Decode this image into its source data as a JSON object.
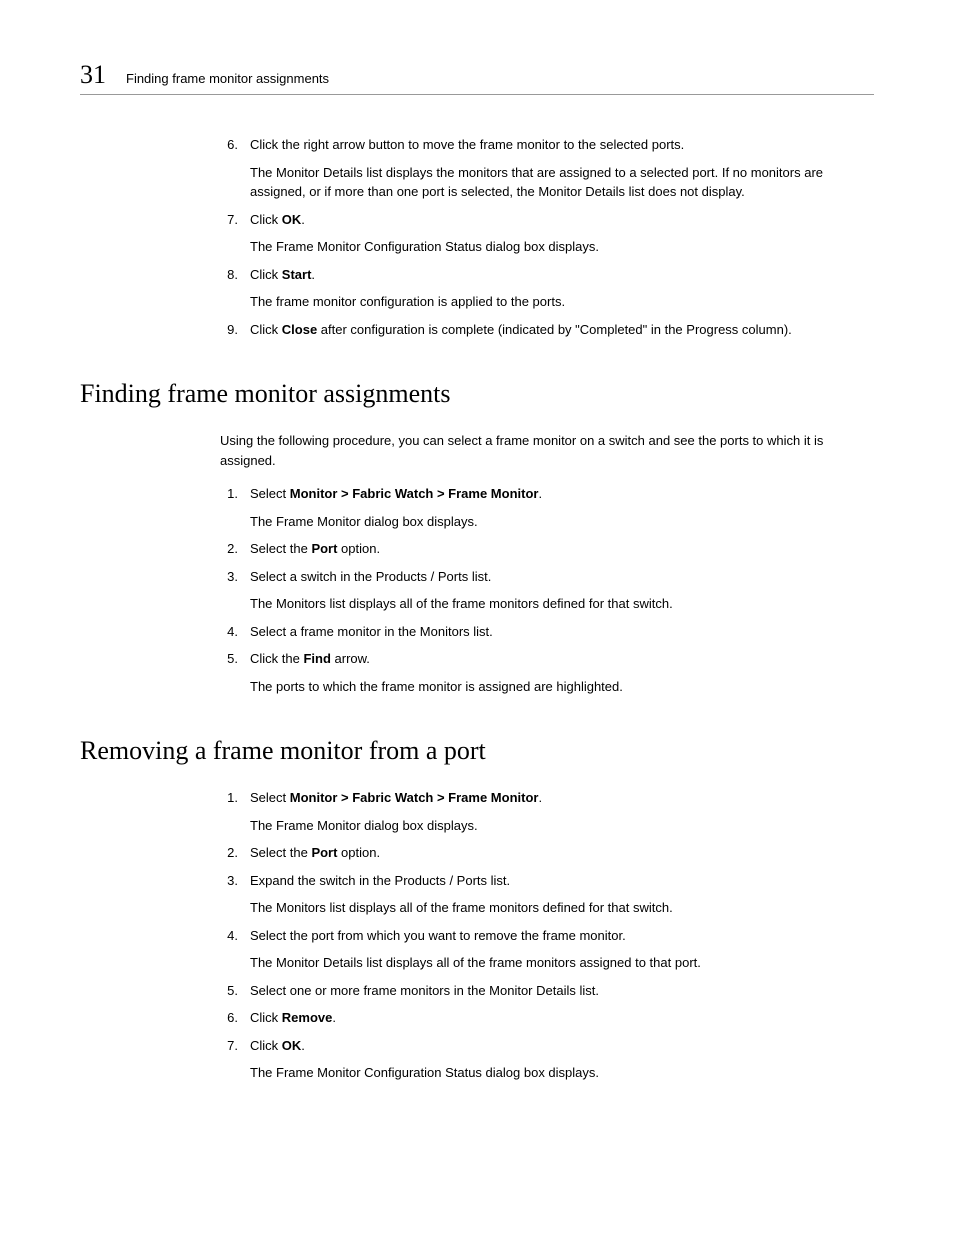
{
  "header": {
    "page_number": "31",
    "running_title": "Finding frame monitor assignments"
  },
  "top_steps": [
    {
      "num": "6.",
      "lines": [
        "Click the right arrow button to move the frame monitor to the selected ports.",
        "The Monitor Details list displays the monitors that are assigned to a selected port. If no monitors are assigned, or if more than one port is selected, the Monitor Details list does not display."
      ]
    },
    {
      "num": "7.",
      "lines": [
        "Click <b>OK</b>.",
        "The Frame Monitor Configuration Status dialog box displays."
      ]
    },
    {
      "num": "8.",
      "lines": [
        "Click <b>Start</b>.",
        "The frame monitor configuration is applied to the ports."
      ]
    },
    {
      "num": "9.",
      "lines": [
        "Click <b>Close</b> after configuration is complete (indicated by \"Completed\" in the Progress column)."
      ]
    }
  ],
  "section1": {
    "title": "Finding frame monitor assignments",
    "intro": "Using the following procedure, you can select a frame monitor on a switch and see the ports to which it is assigned.",
    "steps": [
      {
        "num": "1.",
        "lines": [
          "Select <b>Monitor > Fabric Watch > Frame Monitor</b>.",
          "The Frame Monitor dialog box displays."
        ]
      },
      {
        "num": "2.",
        "lines": [
          "Select the <b>Port</b> option."
        ]
      },
      {
        "num": "3.",
        "lines": [
          "Select a switch in the Products / Ports list.",
          "The Monitors list displays all of the frame monitors defined for that switch."
        ]
      },
      {
        "num": "4.",
        "lines": [
          "Select a frame monitor in the Monitors list."
        ]
      },
      {
        "num": "5.",
        "lines": [
          "Click the <b>Find</b> arrow.",
          "The ports to which the frame monitor is assigned are highlighted."
        ]
      }
    ]
  },
  "section2": {
    "title": "Removing a frame monitor from a port",
    "steps": [
      {
        "num": "1.",
        "lines": [
          "Select <b>Monitor > Fabric Watch > Frame Monitor</b>.",
          "The Frame Monitor dialog box displays."
        ]
      },
      {
        "num": "2.",
        "lines": [
          "Select the <b>Port</b> option."
        ]
      },
      {
        "num": "3.",
        "lines": [
          "Expand the switch in the Products / Ports list.",
          "The Monitors list displays all of the frame monitors defined for that switch."
        ]
      },
      {
        "num": "4.",
        "lines": [
          "Select the port from which you want to remove the frame monitor.",
          "The Monitor Details list displays all of the frame monitors assigned to that port."
        ]
      },
      {
        "num": "5.",
        "lines": [
          "Select one or more frame monitors in the Monitor Details list."
        ]
      },
      {
        "num": "6.",
        "lines": [
          "Click <b>Remove</b>."
        ]
      },
      {
        "num": "7.",
        "lines": [
          "Click <b>OK</b>.",
          "The Frame Monitor Configuration Status dialog box displays."
        ]
      }
    ]
  }
}
